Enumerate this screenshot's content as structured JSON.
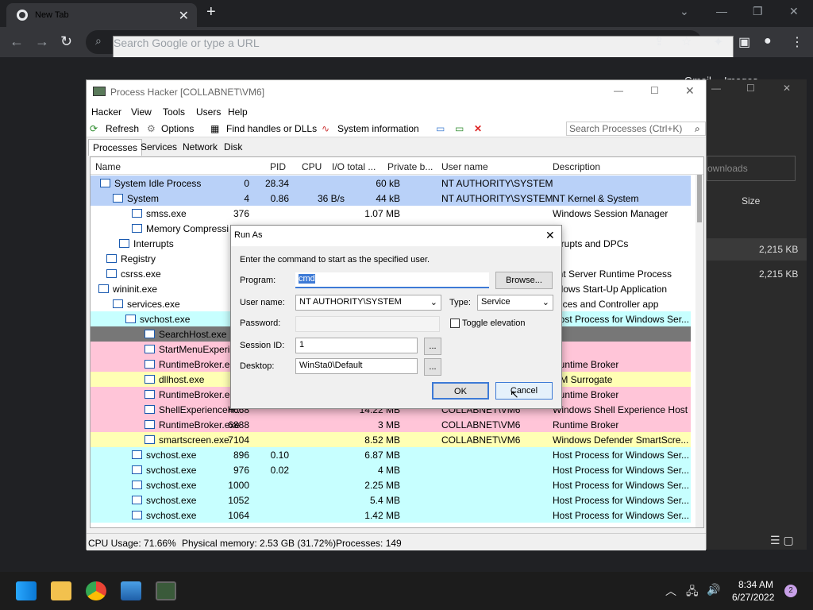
{
  "browser": {
    "tab_title": "New Tab",
    "omnibox_placeholder": "Search Google or type a URL",
    "bg_labels": {
      "gmail": "Gmail",
      "images": "Images",
      "downloads": "ownloads",
      "size": "Size",
      "size1": "2,215 KB",
      "size2": "2,215 KB"
    }
  },
  "process_hacker": {
    "title": "Process Hacker [COLLABNET\\VM6]",
    "menu": [
      "Hacker",
      "View",
      "Tools",
      "Users",
      "Help"
    ],
    "toolbar": {
      "refresh": "Refresh",
      "options": "Options",
      "find": "Find handles or DLLs",
      "sysinfo": "System information"
    },
    "search_placeholder": "Search Processes (Ctrl+K)",
    "tabs": [
      "Processes",
      "Services",
      "Network",
      "Disk"
    ],
    "columns": [
      "Name",
      "PID",
      "CPU",
      "I/O total ...",
      "Private b...",
      "User name",
      "Description"
    ],
    "rows": [
      {
        "name": "System Idle Process",
        "pid": "0",
        "cpu": "28.34",
        "io": "",
        "priv": "60 kB",
        "user": "NT AUTHORITY\\SYSTEM",
        "desc": ""
      },
      {
        "name": "System",
        "pid": "4",
        "cpu": "0.86",
        "io": "36 B/s",
        "priv": "44 kB",
        "user": "NT AUTHORITY\\SYSTEM",
        "desc": "NT Kernel & System"
      },
      {
        "name": "smss.exe",
        "pid": "376",
        "cpu": "",
        "io": "",
        "priv": "1.07 MB",
        "user": "",
        "desc": "Windows Session Manager"
      },
      {
        "name": "Memory Compressi",
        "pid": "",
        "cpu": "",
        "io": "",
        "priv": "",
        "user": "",
        "desc": ""
      },
      {
        "name": "Interrupts",
        "pid": "",
        "cpu": "",
        "io": "",
        "priv": "",
        "user": "",
        "desc": "errupts and DPCs"
      },
      {
        "name": "Registry",
        "pid": "",
        "cpu": "",
        "io": "",
        "priv": "",
        "user": "",
        "desc": ""
      },
      {
        "name": "csrss.exe",
        "pid": "",
        "cpu": "",
        "io": "",
        "priv": "",
        "user": "",
        "desc": "ent Server Runtime Process"
      },
      {
        "name": "wininit.exe",
        "pid": "",
        "cpu": "",
        "io": "",
        "priv": "",
        "user": "",
        "desc": "ndows Start-Up Application"
      },
      {
        "name": "services.exe",
        "pid": "",
        "cpu": "",
        "io": "",
        "priv": "",
        "user": "",
        "desc": "rvices and Controller app"
      },
      {
        "name": "svchost.exe",
        "pid": "",
        "cpu": "",
        "io": "",
        "priv": "",
        "user": "",
        "desc": "Host Process for Windows Ser..."
      },
      {
        "name": "SearchHost.exe",
        "pid": "",
        "cpu": "",
        "io": "",
        "priv": "",
        "user": "",
        "desc": ""
      },
      {
        "name": "StartMenuExperi",
        "pid": "",
        "cpu": "",
        "io": "",
        "priv": "",
        "user": "",
        "desc": ""
      },
      {
        "name": "RuntimeBroker.e",
        "pid": "",
        "cpu": "",
        "io": "",
        "priv": "",
        "user": "",
        "desc": "Runtime Broker"
      },
      {
        "name": "dllhost.exe",
        "pid": "",
        "cpu": "",
        "io": "",
        "priv": "",
        "user": "",
        "desc": "OM Surrogate"
      },
      {
        "name": "RuntimeBroker.e",
        "pid": "",
        "cpu": "",
        "io": "",
        "priv": "",
        "user": "",
        "desc": "Runtime Broker"
      },
      {
        "name": "ShellExperienceH...",
        "pid": "4668",
        "cpu": "",
        "io": "",
        "priv": "14.22 MB",
        "user": "COLLABNET\\VM6",
        "desc": "Windows Shell Experience Host"
      },
      {
        "name": "RuntimeBroker.exe",
        "pid": "6888",
        "cpu": "",
        "io": "",
        "priv": "3 MB",
        "user": "COLLABNET\\VM6",
        "desc": "Runtime Broker"
      },
      {
        "name": "smartscreen.exe",
        "pid": "7104",
        "cpu": "",
        "io": "",
        "priv": "8.52 MB",
        "user": "COLLABNET\\VM6",
        "desc": "Windows Defender SmartScre..."
      },
      {
        "name": "svchost.exe",
        "pid": "896",
        "cpu": "0.10",
        "io": "",
        "priv": "6.87 MB",
        "user": "",
        "desc": "Host Process for Windows Ser..."
      },
      {
        "name": "svchost.exe",
        "pid": "976",
        "cpu": "0.02",
        "io": "",
        "priv": "4 MB",
        "user": "",
        "desc": "Host Process for Windows Ser..."
      },
      {
        "name": "svchost.exe",
        "pid": "1000",
        "cpu": "",
        "io": "",
        "priv": "2.25 MB",
        "user": "",
        "desc": "Host Process for Windows Ser..."
      },
      {
        "name": "svchost.exe",
        "pid": "1052",
        "cpu": "",
        "io": "",
        "priv": "5.4 MB",
        "user": "",
        "desc": "Host Process for Windows Ser..."
      },
      {
        "name": "svchost.exe",
        "pid": "1064",
        "cpu": "",
        "io": "",
        "priv": "1.42 MB",
        "user": "",
        "desc": "Host Process for Windows Ser..."
      }
    ],
    "status": {
      "cpu": "CPU Usage: 71.66%",
      "mem": "Physical memory: 2.53 GB (31.72%)",
      "procs": "Processes: 149"
    }
  },
  "run_as": {
    "title": "Run As",
    "intro": "Enter the command to start as the specified user.",
    "program_label": "Program:",
    "program_value": "cmd",
    "browse": "Browse...",
    "user_label": "User name:",
    "user_value": "NT AUTHORITY\\SYSTEM",
    "type_label": "Type:",
    "type_value": "Service",
    "password_label": "Password:",
    "toggle_elevation": "Toggle elevation",
    "session_label": "Session ID:",
    "session_value": "1",
    "desktop_label": "Desktop:",
    "desktop_value": "WinSta0\\Default",
    "ellipsis": "...",
    "ok": "OK",
    "cancel": "Cancel"
  },
  "taskbar": {
    "time": "8:34 AM",
    "date": "6/27/2022",
    "badge": "2"
  },
  "colors": {
    "blue": "#b9d1f8",
    "cyan": "#c7ffff",
    "pink": "#ffc5d8",
    "yellow": "#ffffb4",
    "gray": "#777777"
  }
}
